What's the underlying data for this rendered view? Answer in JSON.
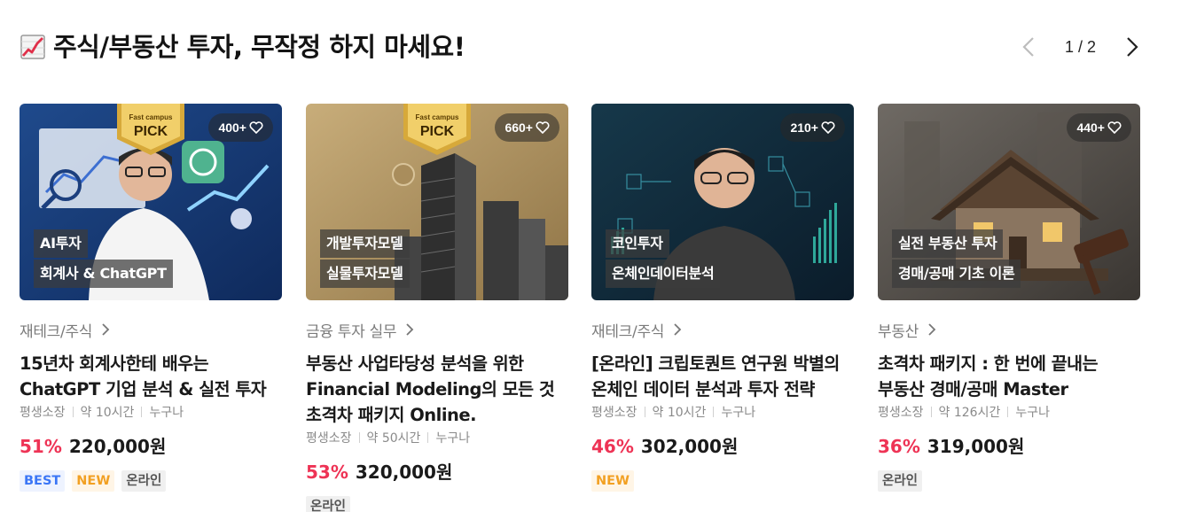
{
  "section": {
    "title": "주식/부동산 투자, 무작정 하지 마세요!",
    "icon": "chart-increasing-icon"
  },
  "pager": {
    "text": "1 / 2",
    "prev_icon": "chevron-left-icon",
    "next_icon": "chevron-right-icon"
  },
  "pick_badge": {
    "line1": "Fast campus",
    "line2": "PICK"
  },
  "cards": [
    {
      "likes": "400+",
      "pick": true,
      "tags": [
        "AI투자",
        "회계사 & ChatGPT"
      ],
      "category": "재테크/주식",
      "title_lines": [
        "15년차 회계사한테 배우는",
        "ChatGPT 기업 분석 & 실전 투자"
      ],
      "meta": [
        "평생소장",
        "약 10시간",
        "누구나"
      ],
      "discount": "51%",
      "price": "220,000원",
      "badges": [
        "BEST",
        "NEW",
        "온라인"
      ]
    },
    {
      "likes": "660+",
      "pick": true,
      "tags": [
        "개발투자모델",
        "실물투자모델"
      ],
      "category": "금융 투자 실무",
      "title_lines": [
        "부동산 사업타당성 분석을 위한",
        "Financial Modeling의 모든 것",
        "초격차 패키지 Online."
      ],
      "meta": [
        "평생소장",
        "약 50시간",
        "누구나"
      ],
      "discount": "53%",
      "price": "320,000원",
      "badges": [
        "온라인"
      ]
    },
    {
      "likes": "210+",
      "pick": false,
      "tags": [
        "코인투자",
        "온체인데이터분석"
      ],
      "category": "재테크/주식",
      "title_lines": [
        "[온라인] 크립토퀀트 연구원 박별의",
        "온체인 데이터 분석과 투자 전략"
      ],
      "meta": [
        "평생소장",
        "약 10시간",
        "누구나"
      ],
      "discount": "46%",
      "price": "302,000원",
      "badges": [
        "NEW"
      ]
    },
    {
      "likes": "440+",
      "pick": false,
      "tags": [
        "실전 부동산 투자",
        "경매/공매 기초 이론"
      ],
      "category": "부동산",
      "title_lines": [
        "초격차 패키지 : 한 번에 끝내는",
        "부동산 경매/공매 Master"
      ],
      "meta": [
        "평생소장",
        "약 126시간",
        "누구나"
      ],
      "discount": "36%",
      "price": "319,000원",
      "badges": [
        "온라인"
      ]
    }
  ],
  "colors": {
    "discount": "#ee3355",
    "best": "#3b76f6",
    "new": "#f2a022"
  }
}
